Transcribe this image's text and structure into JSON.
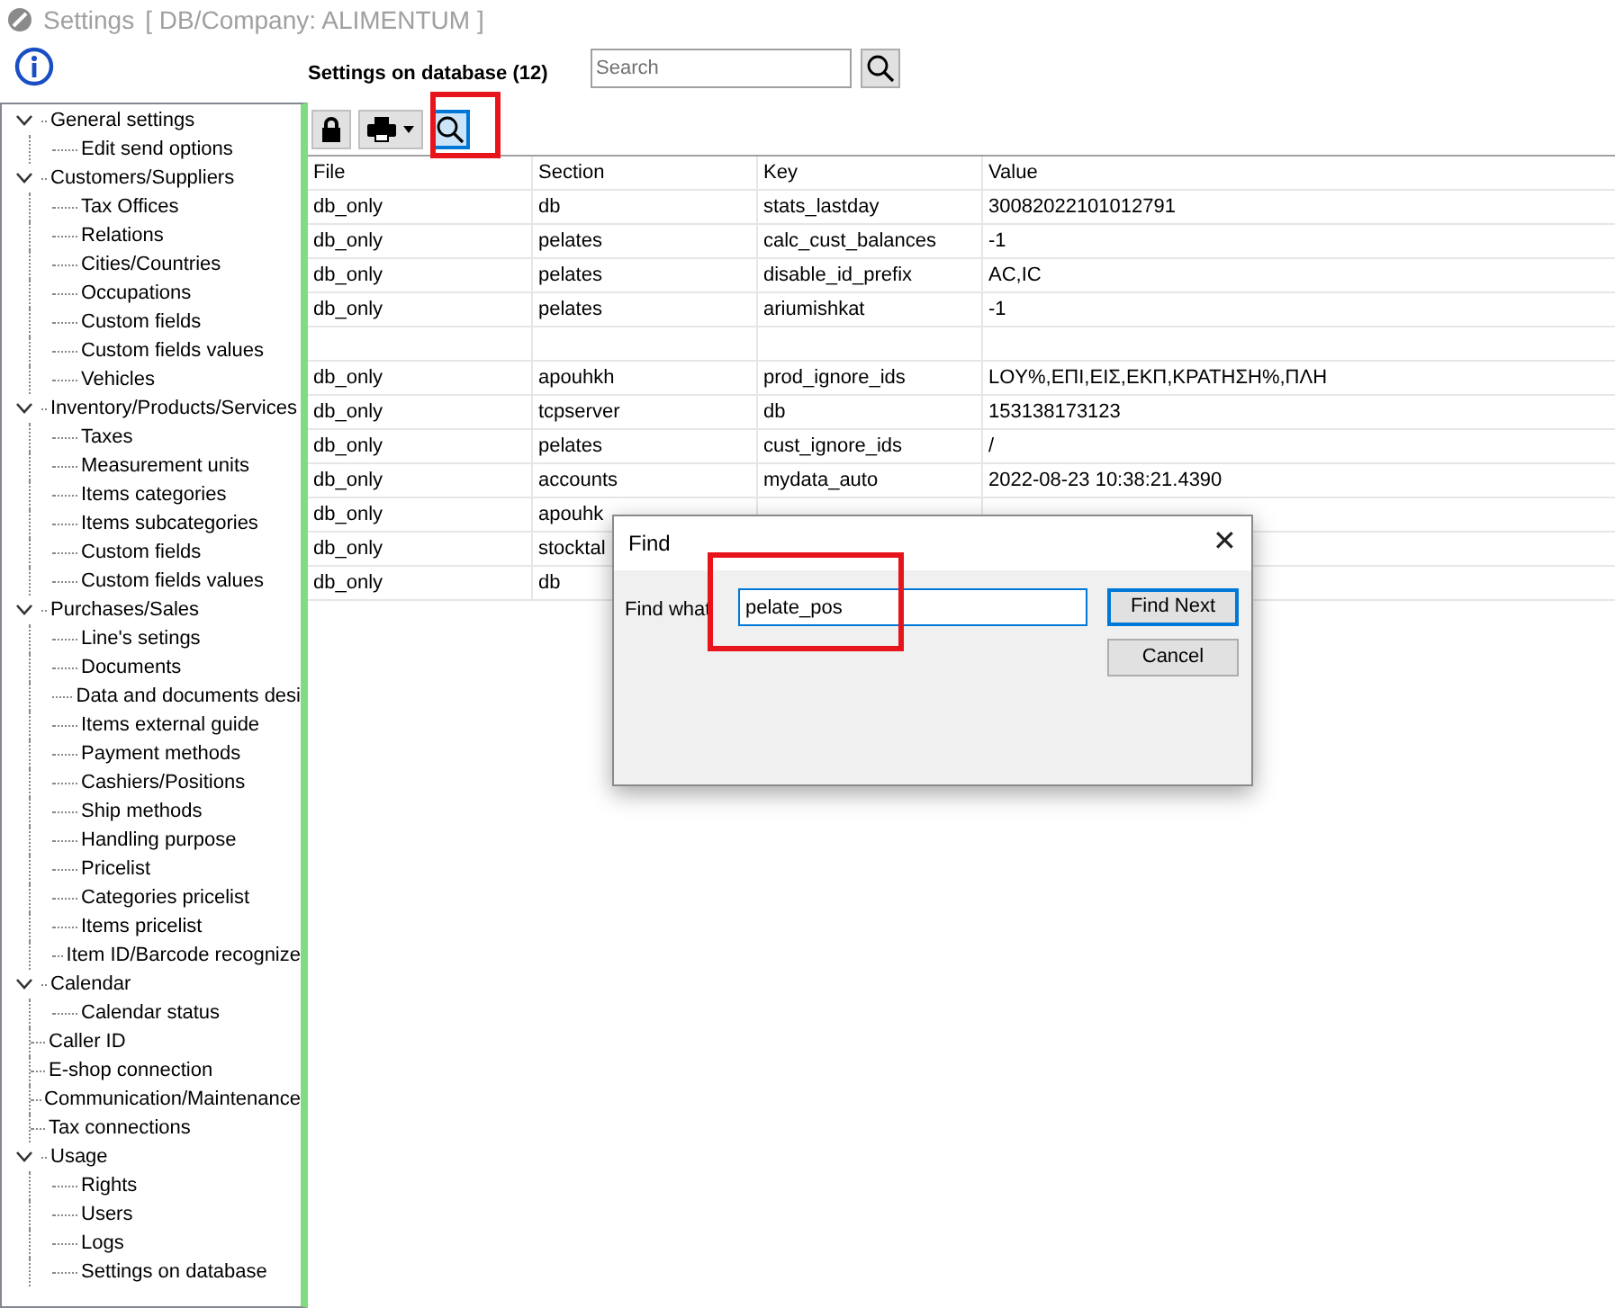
{
  "window": {
    "title": "Settings",
    "subtitle": "[ DB/Company: ALIMENTUM ]"
  },
  "header": {
    "title": "Settings on database (12)",
    "search": {
      "placeholder": "Search"
    }
  },
  "sidebar": {
    "items": [
      {
        "label": "General settings",
        "expanded": true,
        "children": [
          {
            "label": "Edit send options"
          }
        ]
      },
      {
        "label": "Customers/Suppliers",
        "expanded": true,
        "children": [
          {
            "label": "Tax Offices"
          },
          {
            "label": "Relations"
          },
          {
            "label": "Cities/Countries"
          },
          {
            "label": "Occupations"
          },
          {
            "label": "Custom fields"
          },
          {
            "label": "Custom fields values"
          },
          {
            "label": "Vehicles"
          }
        ]
      },
      {
        "label": "Inventory/Products/Services",
        "expanded": true,
        "children": [
          {
            "label": "Taxes"
          },
          {
            "label": "Measurement units"
          },
          {
            "label": "Items categories"
          },
          {
            "label": "Items subcategories"
          },
          {
            "label": "Custom fields"
          },
          {
            "label": "Custom fields values"
          }
        ]
      },
      {
        "label": "Purchases/Sales",
        "expanded": true,
        "children": [
          {
            "label": "Line's setings"
          },
          {
            "label": "Documents"
          },
          {
            "label": "Data and documents desi"
          },
          {
            "label": "Items external guide"
          },
          {
            "label": "Payment methods"
          },
          {
            "label": "Cashiers/Positions"
          },
          {
            "label": "Ship methods"
          },
          {
            "label": "Handling purpose"
          },
          {
            "label": "Pricelist"
          },
          {
            "label": "Categories pricelist"
          },
          {
            "label": "Items pricelist"
          },
          {
            "label": "Item ID/Barcode recognize"
          }
        ]
      },
      {
        "label": "Calendar",
        "expanded": true,
        "children": [
          {
            "label": "Calendar status"
          }
        ]
      },
      {
        "label": "Caller ID"
      },
      {
        "label": "E-shop connection"
      },
      {
        "label": "Communication/Maintenance"
      },
      {
        "label": "Tax connections"
      },
      {
        "label": "Usage",
        "expanded": true,
        "children": [
          {
            "label": "Rights"
          },
          {
            "label": "Users"
          },
          {
            "label": "Logs"
          },
          {
            "label": "Settings on database"
          }
        ]
      }
    ]
  },
  "toolbar": {
    "find_active": true
  },
  "table": {
    "columns": [
      "File",
      "Section",
      "Key",
      "Value"
    ],
    "rows": [
      [
        "db_only",
        "db",
        "stats_lastday",
        "30082022101012791"
      ],
      [
        "db_only",
        "pelates",
        "calc_cust_balances",
        "-1"
      ],
      [
        "db_only",
        "pelates",
        "disable_id_prefix",
        "AC,IC"
      ],
      [
        "db_only",
        "pelates",
        "ariumishkat",
        "-1"
      ],
      [
        "",
        "",
        "",
        ""
      ],
      [
        "db_only",
        "apouhkh",
        "prod_ignore_ids",
        "LOY%,ΕΠΙ,ΕΙΣ,ΕΚΠ,ΚΡΑΤΗΣΗ%,ΠΛΗ"
      ],
      [
        "db_only",
        "tcpserver",
        "db",
        "153138173123"
      ],
      [
        "db_only",
        "pelates",
        "cust_ignore_ids",
        "/"
      ],
      [
        "db_only",
        "accounts",
        "mydata_auto",
        "2022-08-23 10:38:21.4390"
      ],
      [
        "db_only",
        "apouhk",
        "",
        ""
      ],
      [
        "db_only",
        "stocktal",
        "",
        ""
      ],
      [
        "db_only",
        "db",
        "",
        ""
      ]
    ]
  },
  "dialog": {
    "title": "Find",
    "close": "✕",
    "label": "Find what",
    "value": "pelate_pos",
    "buttons": [
      "Find Next",
      "Cancel"
    ]
  }
}
